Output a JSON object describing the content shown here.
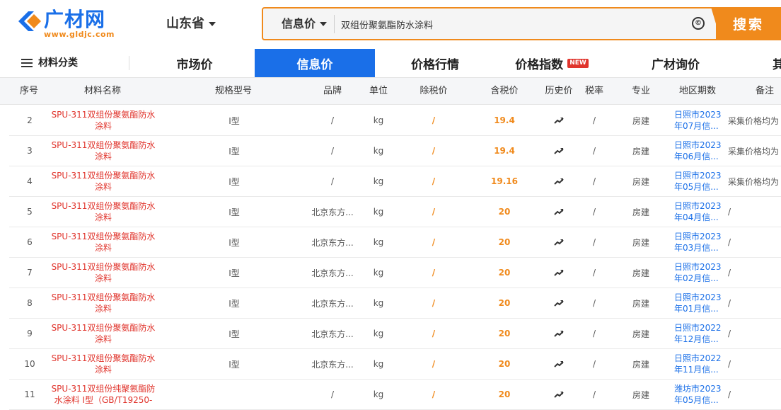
{
  "logo": {
    "name": "广材网",
    "url": "www.gldjc.com"
  },
  "province": "山东省",
  "search": {
    "type": "信息价",
    "value": "双组份聚氨酯防水涂料",
    "clear_symbol": "©",
    "button": "搜索"
  },
  "nav": {
    "category": "材料分类",
    "items": [
      {
        "label": "市场价",
        "active": false
      },
      {
        "label": "信息价",
        "active": true
      },
      {
        "label": "价格行情",
        "active": false
      },
      {
        "label": "价格指数",
        "badge": "NEW",
        "active": false
      },
      {
        "label": "广材询价",
        "active": false
      },
      {
        "label": "其",
        "active": false
      }
    ]
  },
  "table": {
    "columns": [
      "序号",
      "材料名称",
      "规格型号",
      "品牌",
      "单位",
      "除税价",
      "含税价",
      "历史价",
      "税率",
      "专业",
      "地区期数",
      "备注"
    ],
    "rows": [
      {
        "no": "2",
        "name": "SPU-311双组份聚氨酯防水涂料",
        "spec": "Ⅰ型",
        "brand": "/",
        "unit": "kg",
        "pre_tax": "/",
        "price": "19.4",
        "tax": "/",
        "major": "房建",
        "period": "日照市2023年07月信...",
        "note": "采集价格均为"
      },
      {
        "no": "3",
        "name": "SPU-311双组份聚氨酯防水涂料",
        "spec": "Ⅰ型",
        "brand": "/",
        "unit": "kg",
        "pre_tax": "/",
        "price": "19.4",
        "tax": "/",
        "major": "房建",
        "period": "日照市2023年06月信...",
        "note": "采集价格均为"
      },
      {
        "no": "4",
        "name": "SPU-311双组份聚氨酯防水涂料",
        "spec": "Ⅰ型",
        "brand": "/",
        "unit": "kg",
        "pre_tax": "/",
        "price": "19.16",
        "tax": "/",
        "major": "房建",
        "period": "日照市2023年05月信...",
        "note": "采集价格均为"
      },
      {
        "no": "5",
        "name": "SPU-311双组份聚氨酯防水涂料",
        "spec": "Ⅰ型",
        "brand": "北京东方...",
        "unit": "kg",
        "pre_tax": "/",
        "price": "20",
        "tax": "/",
        "major": "房建",
        "period": "日照市2023年04月信...",
        "note": "/"
      },
      {
        "no": "6",
        "name": "SPU-311双组份聚氨酯防水涂料",
        "spec": "Ⅰ型",
        "brand": "北京东方...",
        "unit": "kg",
        "pre_tax": "/",
        "price": "20",
        "tax": "/",
        "major": "房建",
        "period": "日照市2023年03月信...",
        "note": "/"
      },
      {
        "no": "7",
        "name": "SPU-311双组份聚氨酯防水涂料",
        "spec": "Ⅰ型",
        "brand": "北京东方...",
        "unit": "kg",
        "pre_tax": "/",
        "price": "20",
        "tax": "/",
        "major": "房建",
        "period": "日照市2023年02月信...",
        "note": "/"
      },
      {
        "no": "8",
        "name": "SPU-311双组份聚氨酯防水涂料",
        "spec": "Ⅰ型",
        "brand": "北京东方...",
        "unit": "kg",
        "pre_tax": "/",
        "price": "20",
        "tax": "/",
        "major": "房建",
        "period": "日照市2023年01月信...",
        "note": "/"
      },
      {
        "no": "9",
        "name": "SPU-311双组份聚氨酯防水涂料",
        "spec": "Ⅰ型",
        "brand": "北京东方...",
        "unit": "kg",
        "pre_tax": "/",
        "price": "20",
        "tax": "/",
        "major": "房建",
        "period": "日照市2022年12月信...",
        "note": "/"
      },
      {
        "no": "10",
        "name": "SPU-311双组份聚氨酯防水涂料",
        "spec": "Ⅰ型",
        "brand": "北京东方...",
        "unit": "kg",
        "pre_tax": "/",
        "price": "20",
        "tax": "/",
        "major": "房建",
        "period": "日照市2022年11月信...",
        "note": "/"
      },
      {
        "no": "11",
        "name": "SPU-311双组份纯聚氨酯防水涂料 Ⅰ型（GB/T19250-",
        "spec": "",
        "brand": "/",
        "unit": "kg",
        "pre_tax": "/",
        "price": "20",
        "tax": "/",
        "major": "房建",
        "period": "潍坊市2023年05月信...",
        "note": "/"
      }
    ]
  },
  "icons": {
    "trend": "trend-up-icon",
    "menu": "menu-icon",
    "clear": "clear-icon"
  },
  "colors": {
    "brand_blue": "#1a6fe8",
    "accent_orange": "#f08a1c",
    "link_red": "#e0342c"
  }
}
